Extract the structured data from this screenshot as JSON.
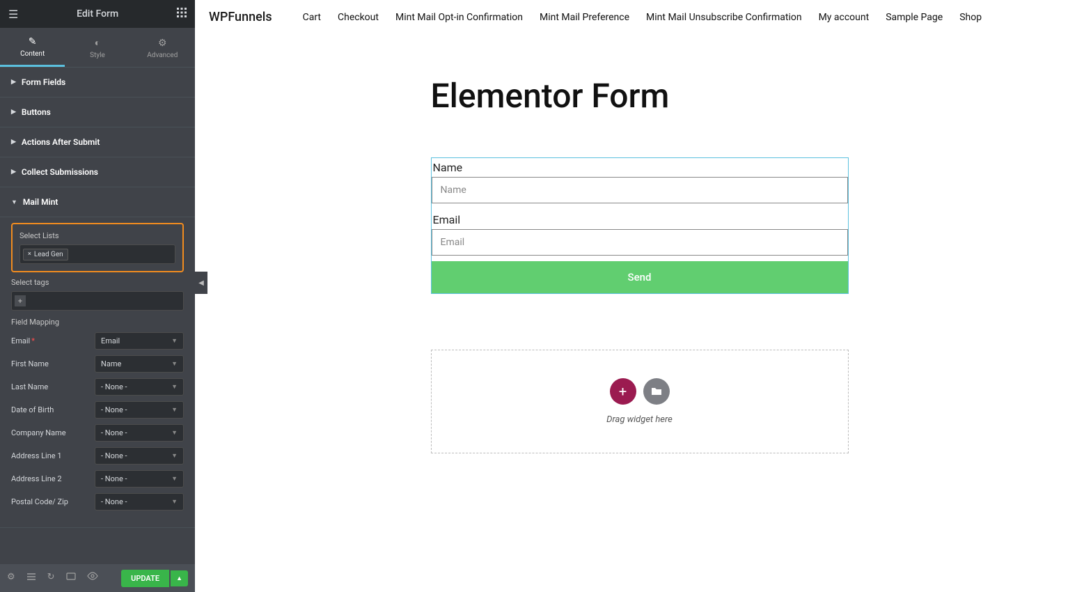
{
  "sidebar": {
    "title": "Edit Form",
    "tabs": {
      "content": "Content",
      "style": "Style",
      "advanced": "Advanced"
    },
    "accordions": {
      "form_fields": "Form Fields",
      "buttons": "Buttons",
      "actions": "Actions After Submit",
      "collect": "Collect Submissions",
      "mailmint": "Mail Mint"
    },
    "mailmint": {
      "select_lists_label": "Select Lists",
      "list_tag": "Lead Gen",
      "select_tags_label": "Select tags",
      "field_mapping_label": "Field Mapping",
      "fields": [
        {
          "label": "Email",
          "required": true,
          "value": "Email"
        },
        {
          "label": "First Name",
          "required": false,
          "value": "Name"
        },
        {
          "label": "Last Name",
          "required": false,
          "value": "- None -"
        },
        {
          "label": "Date of Birth",
          "required": false,
          "value": "- None -"
        },
        {
          "label": "Company Name",
          "required": false,
          "value": "- None -"
        },
        {
          "label": "Address Line 1",
          "required": false,
          "value": "- None -"
        },
        {
          "label": "Address Line 2",
          "required": false,
          "value": "- None -"
        },
        {
          "label": "Postal Code/ Zip",
          "required": false,
          "value": "- None -"
        }
      ]
    },
    "footer": {
      "update": "UPDATE"
    }
  },
  "preview": {
    "brand": "WPFunnels",
    "nav": [
      "Cart",
      "Checkout",
      "Mint Mail Opt-in Confirmation",
      "Mint Mail Preference",
      "Mint Mail Unsubscribe Confirmation",
      "My account",
      "Sample Page",
      "Shop"
    ],
    "title": "Elementor Form",
    "form": {
      "name_label": "Name",
      "name_placeholder": "Name",
      "email_label": "Email",
      "email_placeholder": "Email",
      "submit": "Send"
    },
    "dropzone": "Drag widget here"
  }
}
